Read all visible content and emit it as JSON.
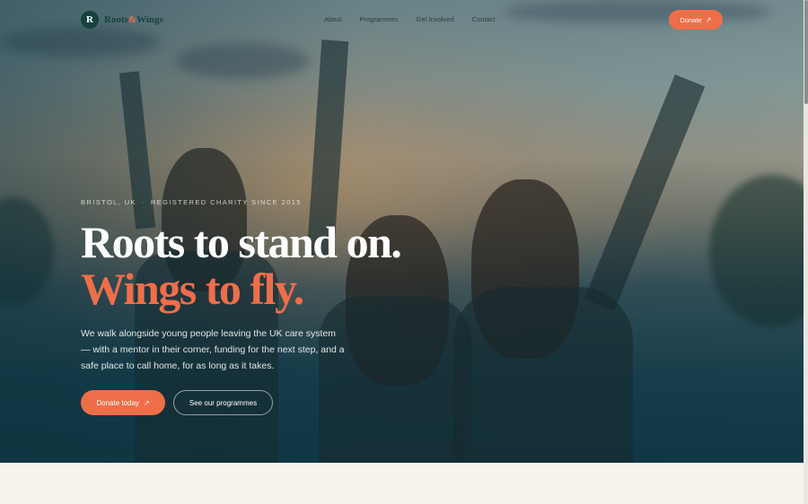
{
  "brand": {
    "mark": "R",
    "name_part1": "Roots",
    "name_amp": "&",
    "name_part2": "Wings"
  },
  "nav": {
    "links": [
      "About",
      "Programmes",
      "Get Involved",
      "Contact"
    ],
    "donate_label": "Donate",
    "donate_icon": "arrow-up-right-icon"
  },
  "hero": {
    "eyebrow_location": "BRISTOL, UK",
    "eyebrow_separator": "·",
    "eyebrow_charity": "REGISTERED CHARITY SINCE 2015",
    "headline_line1": "Roots to stand on.",
    "headline_line2": "Wings to fly.",
    "lede": "We walk alongside young people leaving the UK care system — with a mentor in their corner, funding for the next step, and a safe place to call home, for as long as it takes.",
    "cta_primary": "Donate today",
    "cta_primary_icon": "arrow-up-right-icon",
    "cta_secondary": "See our programmes"
  },
  "colors": {
    "accent": "#ef6e4a",
    "brand_dark": "#17423f",
    "hero_overlay": "#113845",
    "page_bg": "#f7f3ec"
  }
}
